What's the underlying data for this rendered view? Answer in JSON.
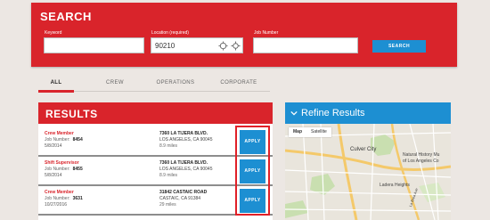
{
  "search": {
    "title": "SEARCH",
    "keyword_label": "Keyword",
    "location_label": "Location (required)",
    "location_value": "90210",
    "job_number_label": "Job Number",
    "button_label": "SEARCH"
  },
  "tabs": [
    {
      "label": "ALL",
      "active": true
    },
    {
      "label": "CREW",
      "active": false
    },
    {
      "label": "OPERATIONS",
      "active": false
    },
    {
      "label": "CORPORATE",
      "active": false
    }
  ],
  "results": {
    "title": "RESULTS",
    "job_number_label": "Job Number:",
    "apply_label": "APPLY",
    "items": [
      {
        "title": "Crew Member",
        "job_number": "8454",
        "date": "5/8/2014",
        "address1": "7360 LA TIJERA BLVD.",
        "address2": "LOS ANGELES, CA 90045",
        "distance": "8.9 miles"
      },
      {
        "title": "Shift Supervisor",
        "job_number": "8455",
        "date": "5/8/2014",
        "address1": "7360 LA TIJERA BLVD.",
        "address2": "LOS ANGELES, CA 90045",
        "distance": "8.9 miles"
      },
      {
        "title": "Crew Member",
        "job_number": "3631",
        "date": "10/27/2016",
        "address1": "31842 CASTAIC ROAD",
        "address2": "CASTAIC, CA 91384",
        "distance": "29 miles"
      }
    ]
  },
  "refine": {
    "title": "Refine Results",
    "map": {
      "view_options": [
        "Map",
        "Satellite"
      ],
      "labels": [
        "Culver City",
        "Natural History Mu",
        "of Los Angeles Co",
        "Ladera Heights",
        "La Brea Ave"
      ]
    }
  },
  "colors": {
    "brand_red": "#d9242b",
    "accent_blue": "#1d8fd2"
  }
}
